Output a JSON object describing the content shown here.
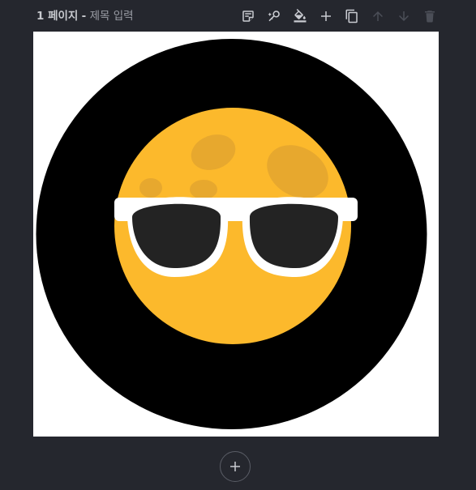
{
  "header": {
    "page_label": "1 페이지",
    "separator": "-",
    "title_placeholder": "제목 입력"
  },
  "toolbar": {
    "tools": [
      {
        "icon": "notes-icon",
        "enabled": true
      },
      {
        "icon": "magic-wand-icon",
        "enabled": true
      },
      {
        "icon": "paint-bucket-icon",
        "enabled": true
      },
      {
        "icon": "plus-icon",
        "enabled": true
      },
      {
        "icon": "duplicate-icon",
        "enabled": true
      },
      {
        "icon": "arrow-up-icon",
        "enabled": false
      },
      {
        "icon": "arrow-down-icon",
        "enabled": false
      },
      {
        "icon": "trash-icon",
        "enabled": false
      }
    ]
  },
  "canvas": {
    "background": "#ffffff",
    "image": "moon-with-sunglasses-icon",
    "colors": {
      "outer_circle": "#000000",
      "moon": "#fcb92c",
      "craters": "#e7a82e",
      "glasses_frame": "#ffffff",
      "lenses": "#232323"
    }
  },
  "footer": {
    "add_page_icon": "plus-icon"
  },
  "colors": {
    "app_background": "#25272e",
    "icon_enabled": "#c9cbd1",
    "icon_disabled": "#4b4e57"
  }
}
